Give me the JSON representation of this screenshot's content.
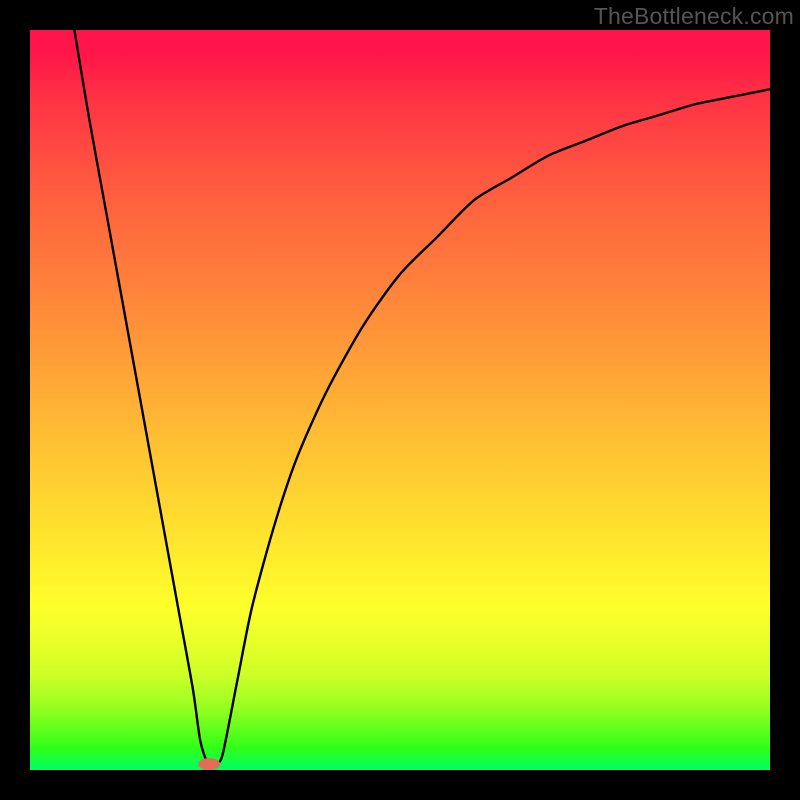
{
  "watermark": "TheBottleneck.com",
  "chart_data": {
    "type": "line",
    "title": "",
    "xlabel": "",
    "ylabel": "",
    "xlim": [
      0,
      100
    ],
    "ylim": [
      0,
      100
    ],
    "x": [
      6,
      8,
      10,
      12,
      14,
      16,
      18,
      20,
      22,
      23,
      24,
      25,
      26,
      28,
      30,
      33,
      36,
      40,
      45,
      50,
      55,
      60,
      65,
      70,
      75,
      80,
      85,
      90,
      95,
      100
    ],
    "values": [
      100,
      88,
      77,
      66,
      55,
      44,
      33,
      22,
      11,
      4,
      1,
      1,
      2,
      12,
      22,
      33,
      42,
      51,
      60,
      67,
      72,
      77,
      80,
      83,
      85,
      87,
      88.5,
      90,
      91,
      92
    ],
    "marker": {
      "x": 24.2,
      "y": 0.8,
      "color": "#e16c59"
    },
    "curve_color": "#000000",
    "background_gradient": {
      "top": "#ff1549",
      "bottom": "#00ff66"
    }
  }
}
